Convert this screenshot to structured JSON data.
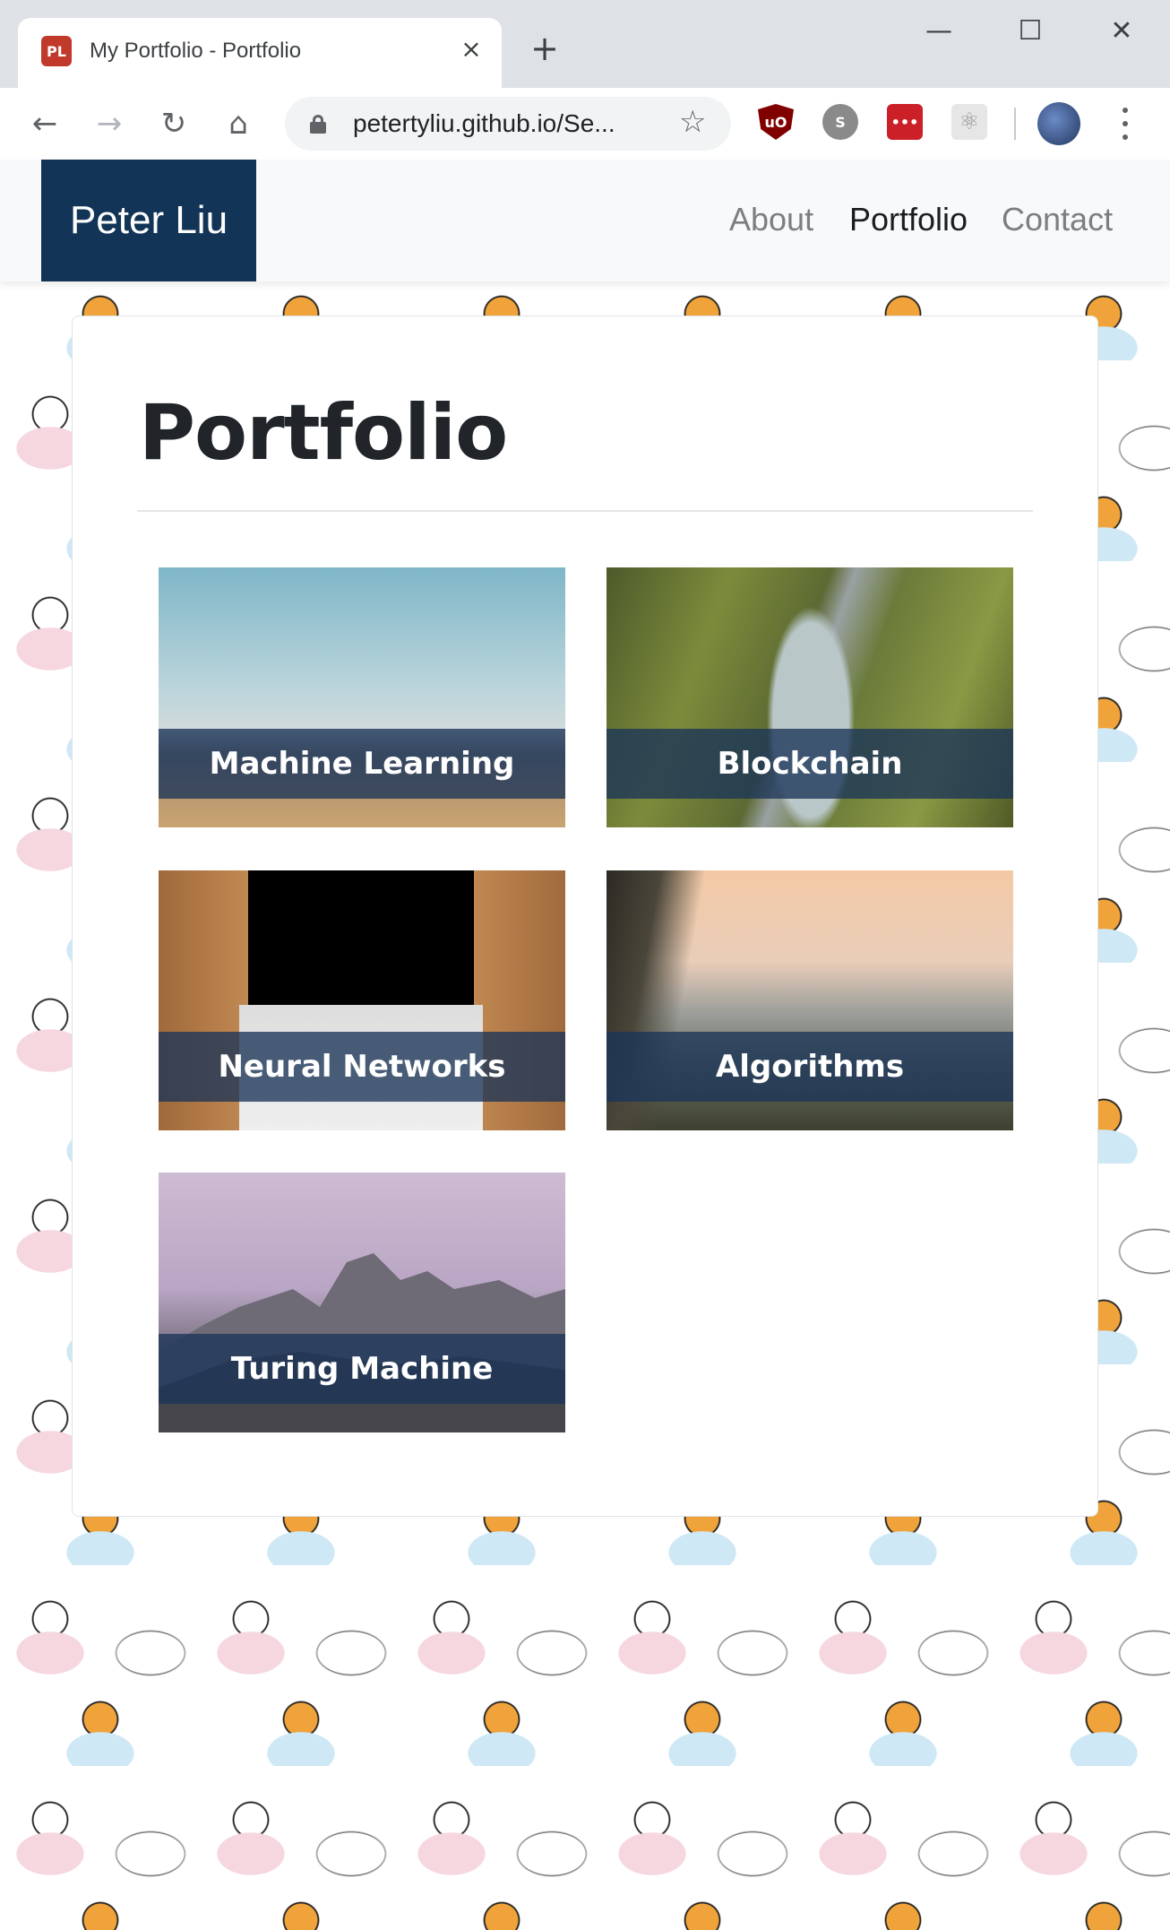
{
  "browser": {
    "tab": {
      "favicon": "PL",
      "title": "My Portfolio - Portfolio",
      "close_icon": "×"
    },
    "new_tab_icon": "+",
    "window_controls": {
      "minimize": "—",
      "maximize": "☐",
      "close": "✕"
    },
    "toolbar": {
      "back_icon": "←",
      "forward_icon": "→",
      "reload_icon": "↻",
      "home_icon": "⌂",
      "url": "petertyliu.github.io/Se...",
      "bookmark_icon": "☆",
      "extensions": [
        {
          "name": "ublock-origin",
          "glyph": "uO",
          "color": "#800000"
        },
        {
          "name": "skype",
          "glyph": "S",
          "color": "#8a8a8a"
        },
        {
          "name": "lastpass",
          "glyph": "•••",
          "color": "#cc2029"
        },
        {
          "name": "react-devtools",
          "glyph": "⚛",
          "color": "#c9c9c9"
        }
      ]
    }
  },
  "site": {
    "brand": "Peter Liu",
    "nav": [
      {
        "label": "About",
        "active": false
      },
      {
        "label": "Portfolio",
        "active": true
      },
      {
        "label": "Contact",
        "active": false
      }
    ],
    "page_title": "Portfolio",
    "projects": [
      {
        "title": "Machine Learning"
      },
      {
        "title": "Blockchain"
      },
      {
        "title": "Neural Networks"
      },
      {
        "title": "Algorithms"
      },
      {
        "title": "Turing Machine"
      }
    ],
    "colors": {
      "brand_bg": "#123456",
      "caption_bg": "#1b3458",
      "active_nav": "#1b1e21",
      "inactive_nav": "#7b7e82"
    }
  }
}
